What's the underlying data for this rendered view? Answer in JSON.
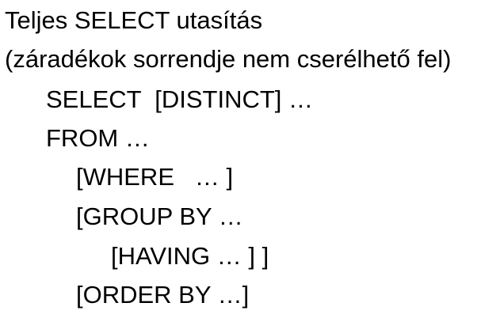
{
  "document": {
    "lines": [
      "Teljes SELECT utasítás",
      "(záradékok sorrendje nem cserélhető fel)",
      "SELECT  [DISTINCT] …",
      "FROM …",
      "[WHERE   … ]",
      "[GROUP BY …",
      "[HAVING … ] ]",
      "[ORDER BY …]"
    ]
  }
}
